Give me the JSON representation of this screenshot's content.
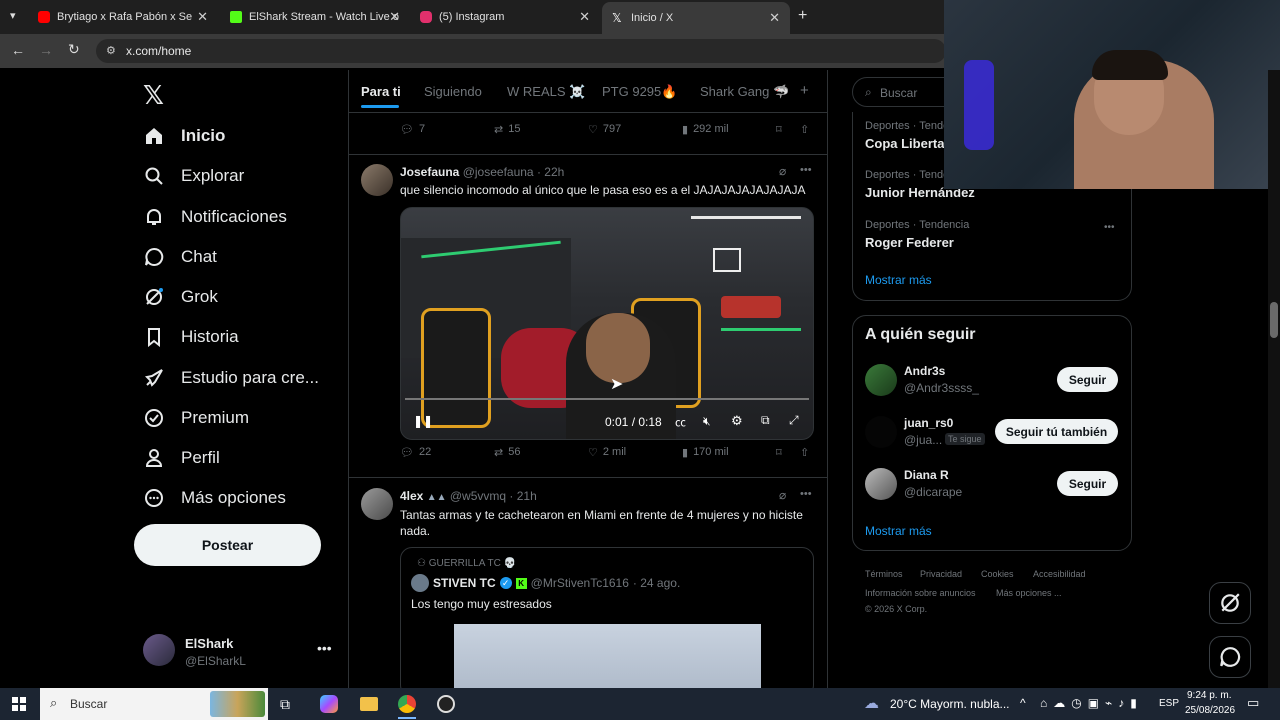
{
  "browser": {
    "tabs": [
      {
        "title": "Brytiago x Rafa Pabón x Se",
        "color": "#ff0000"
      },
      {
        "title": "ElShark Stream - Watch Live on",
        "color": "#53fc18"
      },
      {
        "title": "(5) Instagram",
        "color": "#e1306c"
      },
      {
        "title": "Inicio / X",
        "color": "#ffffff"
      }
    ],
    "url": "x.com/home"
  },
  "nav": {
    "items": [
      "Inicio",
      "Explorar",
      "Notificaciones",
      "Chat",
      "Grok",
      "Historia",
      "Estudio para cre...",
      "Premium",
      "Perfil",
      "Más opciones"
    ],
    "post_label": "Postear",
    "account_name": "ElShark",
    "account_handle": "@ElSharkL"
  },
  "feed": {
    "tabs": [
      "Para ti",
      "Siguiendo",
      "W REALS ☠️",
      "PTG 9295🔥",
      "Shark Gang 🦈"
    ],
    "prev_stats": {
      "replies": "7",
      "reposts": "15",
      "likes": "797",
      "views": "292 mil"
    },
    "post1": {
      "name": "Josefauna",
      "handle": "@joseefauna",
      "time": "· 22h",
      "text": "que silencio incomodo al único que le pasa eso es a el JAJAJAJAJAJAJAJA",
      "video_time": "0:01 / 0:18",
      "stats": {
        "replies": "22",
        "reposts": "56",
        "likes": "2 mil",
        "views": "170 mil"
      }
    },
    "post2": {
      "name": "4lex",
      "handle": "@w5vvmq",
      "time": "· 21h",
      "text": "Tantas armas y te cachetearon en Miami en frente de 4 mujeres y no hiciste nada.",
      "quote_context": "GUERRILLA TC 💀",
      "quote_name": "STIVEN TC",
      "quote_handle": "@MrStivenTc1616",
      "quote_time": "· 24 ago.",
      "quote_text": "Los tengo muy estresados"
    }
  },
  "right": {
    "search_placeholder": "Buscar",
    "trends": [
      {
        "category": "Deportes · Tendencia",
        "name": "Copa Libertadores"
      },
      {
        "category": "Deportes · Tendencia",
        "name": "Junior Hernández"
      },
      {
        "category": "Deportes · Tendencia",
        "name": "Roger Federer"
      }
    ],
    "show_more": "Mostrar más",
    "who_to_follow_title": "A quién seguir",
    "follow": [
      {
        "name": "Andr3s",
        "handle": "@Andr3ssss_",
        "button": "Seguir",
        "badge": ""
      },
      {
        "name": "juan_rs0",
        "handle": "@jua...",
        "button": "Seguir tú también",
        "badge": "Te sigue"
      },
      {
        "name": "Diana R",
        "handle": "@dicarape",
        "button": "Seguir",
        "badge": ""
      }
    ],
    "show_more2": "Mostrar más",
    "footer": [
      "Términos",
      "Privacidad",
      "Cookies",
      "Accesibilidad",
      "Información sobre anuncios",
      "Más opciones ...",
      "© 2026 X Corp."
    ]
  },
  "taskbar": {
    "search": "Buscar",
    "weather": "20°C  Mayorm. nubla...",
    "lang": "ESP",
    "time": "9:24 p. m.",
    "date": "25/08/2026"
  },
  "colors": {
    "accent": "#1d9bf0",
    "border": "#2f3336",
    "muted": "#71767b"
  }
}
